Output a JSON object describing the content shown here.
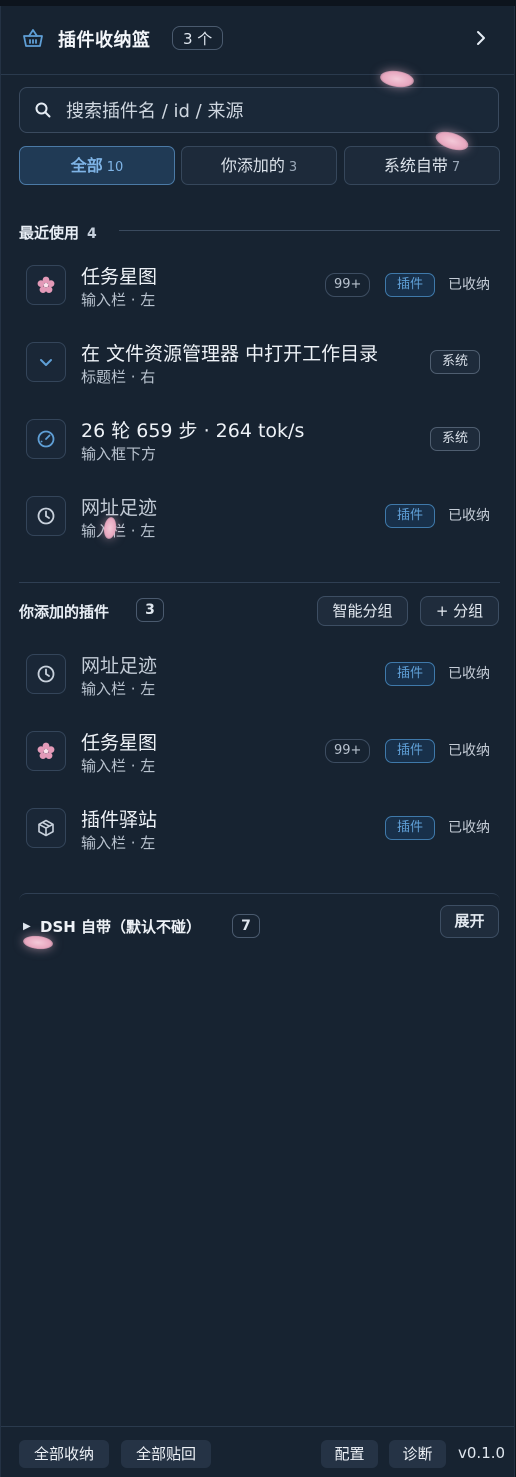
{
  "header": {
    "title": "插件收纳篮",
    "count": "3 个"
  },
  "search": {
    "placeholder": "搜索插件名 / id / 来源"
  },
  "tabs": [
    {
      "label": "全部",
      "count": "10"
    },
    {
      "label": "你添加的",
      "count": "3"
    },
    {
      "label": "系统自带",
      "count": "7"
    }
  ],
  "recent": {
    "title": "最近使用",
    "count": "4",
    "items": [
      {
        "name": "任务星图",
        "location": "输入栏 · 左",
        "badge": "99+",
        "tag": "插件",
        "status": "已收纳",
        "icon": "flower-icon"
      },
      {
        "name": "在 文件资源管理器 中打开工作目录",
        "location": "标题栏 · 右",
        "tag": "系统",
        "icon": "chevron-down-icon"
      },
      {
        "name": "26 轮 659 步 · 264 tok/s",
        "location": "输入框下方",
        "tag": "系统",
        "icon": "speedometer-icon"
      },
      {
        "name": "网址足迹",
        "location": "输入栏 · 左",
        "tag": "插件",
        "status": "已收纳",
        "icon": "clock-icon"
      }
    ]
  },
  "added": {
    "title": "你添加的插件",
    "count": "3",
    "smart_group_label": "智能分组",
    "add_group_label": "+ 分组",
    "items": [
      {
        "name": "网址足迹",
        "location": "输入栏 · 左",
        "tag": "插件",
        "status": "已收纳",
        "icon": "clock-icon"
      },
      {
        "name": "任务星图",
        "location": "输入栏 · 左",
        "badge": "99+",
        "tag": "插件",
        "status": "已收纳",
        "icon": "flower-icon"
      },
      {
        "name": "插件驿站",
        "location": "输入栏 · 左",
        "tag": "插件",
        "status": "已收纳",
        "icon": "box-icon"
      }
    ]
  },
  "dsh": {
    "label": "DSH 自带（默认不碰）",
    "count": "7",
    "expand_label": "展开"
  },
  "footer": {
    "collapse_all": "全部收纳",
    "restore_all": "全部贴回",
    "config": "配置",
    "diagnose": "诊断",
    "version": "v0.1.0"
  },
  "colors": {
    "accent": "#5f9fd6",
    "panel_bg": "#172331",
    "petal": "#e7a7bf"
  }
}
